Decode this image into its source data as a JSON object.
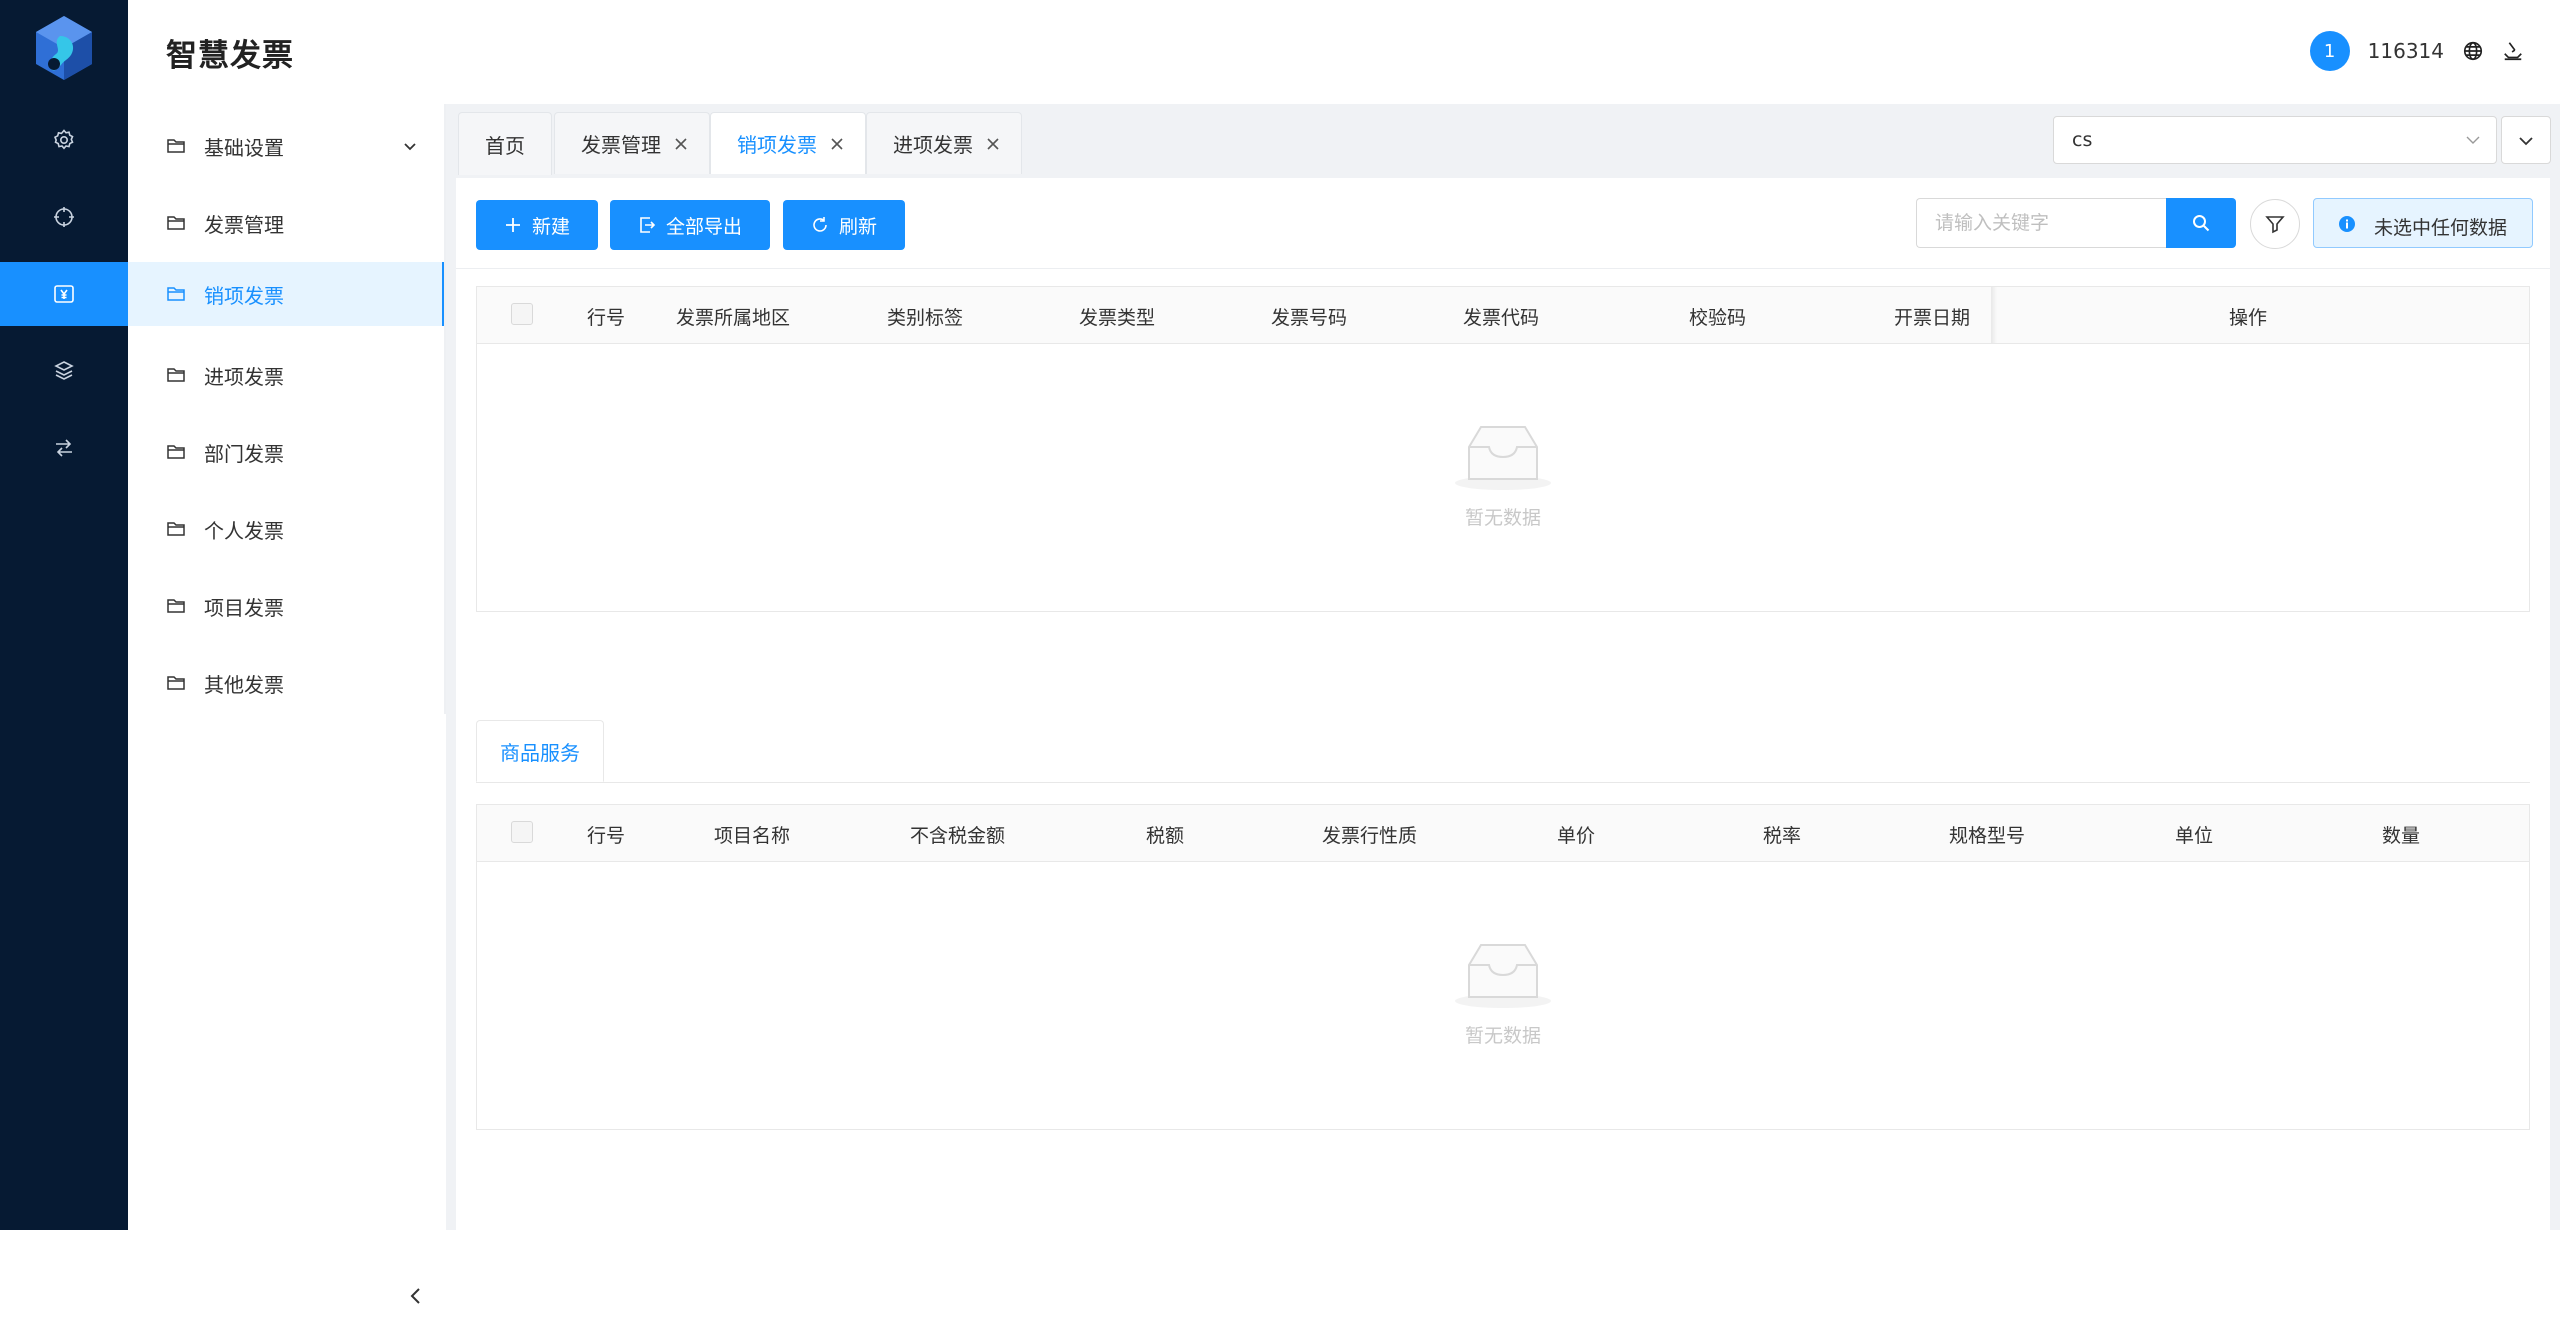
{
  "app": {
    "title": "智慧发票"
  },
  "header": {
    "avatar_text": "1",
    "user_id": "116314"
  },
  "rail": {
    "icons": [
      "gear-icon",
      "target-icon",
      "yuan-invoice-icon",
      "layers-icon",
      "transfer-icon"
    ],
    "active_index": 2
  },
  "sidebar": {
    "items": [
      {
        "label": "基础设置",
        "expandable": true
      },
      {
        "label": "发票管理"
      },
      {
        "label": "销项发票",
        "active": true
      },
      {
        "label": "进项发票"
      },
      {
        "label": "部门发票"
      },
      {
        "label": "个人发票"
      },
      {
        "label": "项目发票"
      },
      {
        "label": "其他发票"
      }
    ]
  },
  "tabs": [
    {
      "label": "首页",
      "closable": false
    },
    {
      "label": "发票管理",
      "closable": true
    },
    {
      "label": "销项发票",
      "closable": true,
      "active": true
    },
    {
      "label": "进项发票",
      "closable": true
    }
  ],
  "company_select": {
    "value": "cs"
  },
  "toolbar": {
    "new_label": "新建",
    "export_label": "全部导出",
    "refresh_label": "刷新",
    "search_placeholder": "请输入关键字",
    "selection_info": "未选中任何数据"
  },
  "main_table": {
    "columns": [
      "行号",
      "发票所属地区",
      "类别标签",
      "发票类型",
      "发票号码",
      "发票代码",
      "校验码",
      "开票日期",
      "操作"
    ],
    "rows": [],
    "empty_text": "暂无数据"
  },
  "sub_tabs": [
    {
      "label": "商品服务",
      "active": true
    }
  ],
  "detail_table": {
    "columns": [
      "行号",
      "项目名称",
      "不含税金额",
      "税额",
      "发票行性质",
      "单价",
      "税率",
      "规格型号",
      "单位",
      "数量"
    ],
    "rows": [],
    "empty_text": "暂无数据"
  },
  "colors": {
    "primary": "#1890ff",
    "rail_bg": "#061a33",
    "active_bg": "#e6f4ff"
  }
}
